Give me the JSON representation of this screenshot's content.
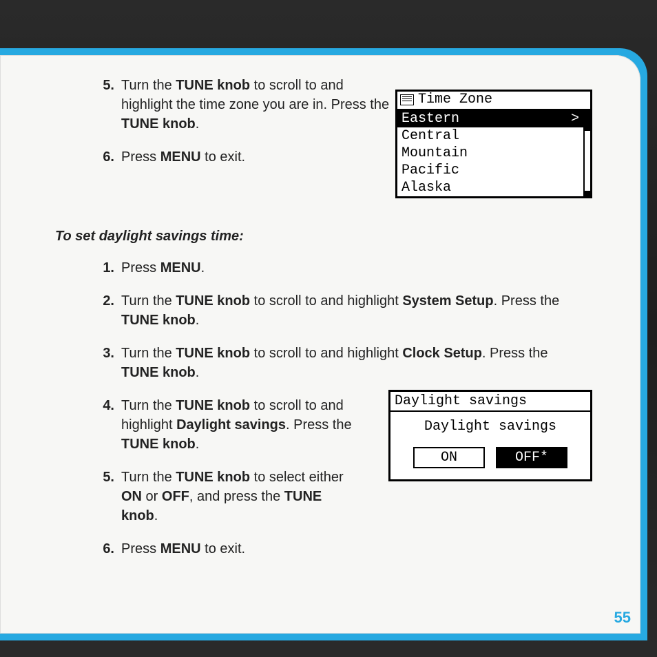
{
  "steps_top": {
    "s5": {
      "n": "5.",
      "pre": "Turn the ",
      "b1": "TUNE knob",
      "mid": " to scroll to and highlight the time zone you are in. Press the ",
      "b2": "TUNE knob",
      "post": "."
    },
    "s6": {
      "n": "6.",
      "pre": "Press ",
      "b1": "MENU",
      "post": " to exit."
    }
  },
  "subhead": "To set daylight savings time:",
  "steps_ds": {
    "s1": {
      "n": "1.",
      "pre": "Press ",
      "b1": "MENU",
      "post": "."
    },
    "s2": {
      "n": "2.",
      "pre": "Turn the ",
      "b1": "TUNE knob",
      "mid": " to scroll to and highlight ",
      "b2": "System Setup",
      "mid2": ". Press the ",
      "b3": "TUNE knob",
      "post": "."
    },
    "s3": {
      "n": "3.",
      "pre": "Turn the ",
      "b1": "TUNE knob",
      "mid": " to scroll to and highlight ",
      "b2": "Clock Setup",
      "mid2": ". Press the ",
      "b3": "TUNE knob",
      "post": "."
    },
    "s4": {
      "n": "4.",
      "pre": "Turn the ",
      "b1": "TUNE knob",
      "mid": " to scroll to and highlight ",
      "b2": "Daylight savings",
      "mid2": ". Press the ",
      "b3": "TUNE knob",
      "post": "."
    },
    "s5": {
      "n": "5.",
      "pre": "Turn the ",
      "b1": "TUNE knob",
      "mid": " to select either ",
      "b2": "ON",
      "mid2": " or ",
      "b3": "OFF",
      "mid3": ", and press the ",
      "b4": "TUNE knob",
      "post": "."
    },
    "s6": {
      "n": "6.",
      "pre": "Press ",
      "b1": "MENU",
      "post": " to exit."
    }
  },
  "tz": {
    "title": "Time Zone",
    "items": {
      "i0": "Eastern",
      "i1": "Central",
      "i2": "Mountain",
      "i3": "Pacific",
      "i4": "Alaska"
    },
    "chevron": ">"
  },
  "ds": {
    "title": "Daylight savings",
    "label": "Daylight savings",
    "on": "ON",
    "off": "OFF*"
  },
  "pagenum": "55"
}
